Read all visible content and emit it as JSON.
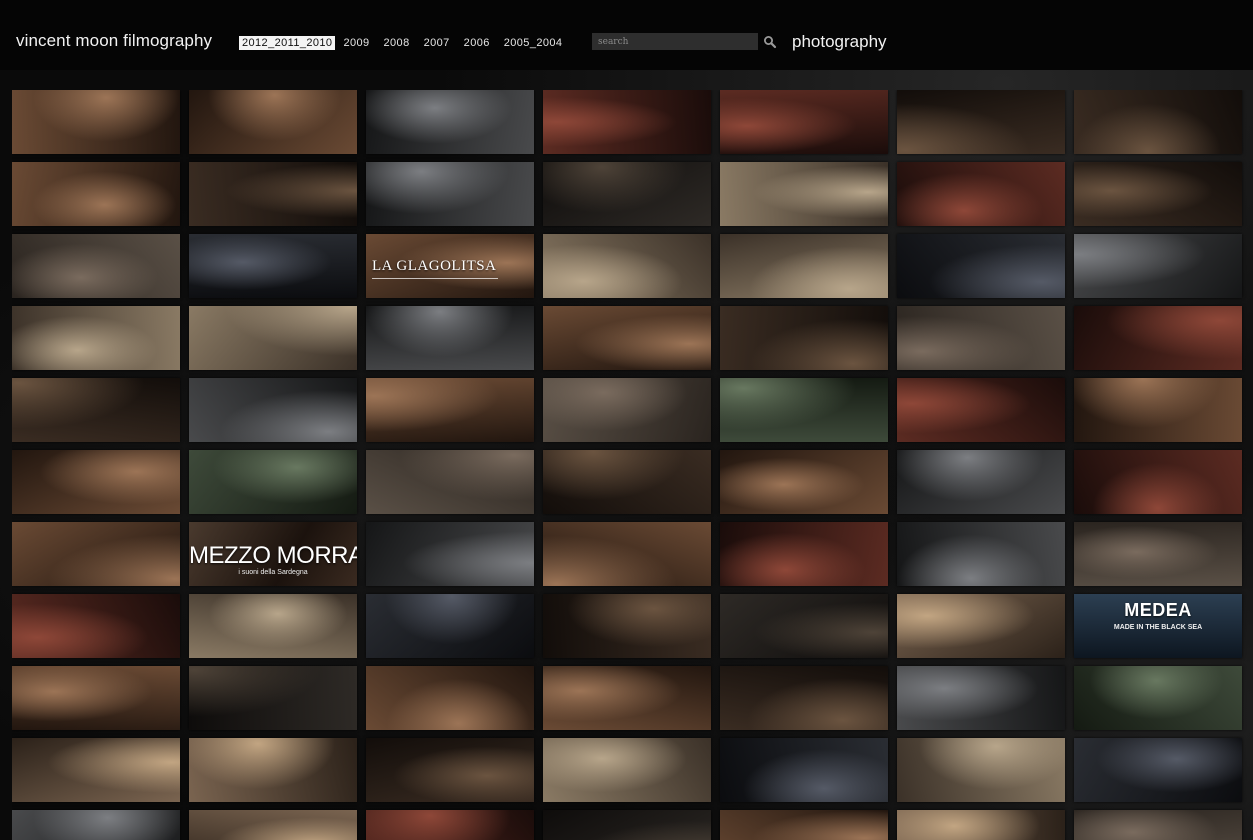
{
  "header": {
    "site_title": "vincent moon filmography",
    "years": [
      "2012_2011_2010",
      "2009",
      "2008",
      "2007",
      "2006",
      "2005_2004"
    ],
    "active_year": "2012_2011_2010",
    "search": {
      "placeholder": "search",
      "value": "",
      "icon": "magnifier-icon"
    },
    "photography_label": "photography"
  },
  "colors": {
    "background": "#050505",
    "header_text": "#f2f2f2",
    "active_year_bg": "#f4f4f4",
    "search_bg": "#2e2e2e"
  },
  "grid": {
    "columns": 7,
    "rows": 11,
    "thumb_titles": [
      {
        "row": 2,
        "col": 2,
        "text": "LA GLAGOLITSA",
        "subtitle": "",
        "style": "lg"
      },
      {
        "row": 6,
        "col": 1,
        "text": "MEZZO MORRA",
        "subtitle": "i suoni della Sardegna",
        "style": "mz"
      },
      {
        "row": 7,
        "col": 6,
        "text": "MEDEA",
        "subtitle": "MADE IN THE BLACK SEA",
        "style": "md"
      }
    ]
  }
}
